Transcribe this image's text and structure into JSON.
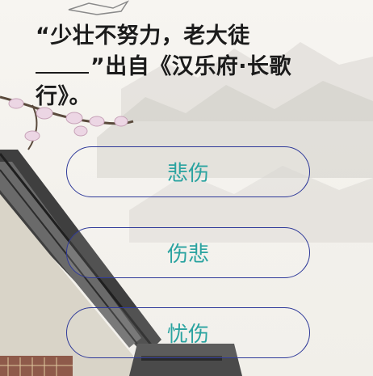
{
  "question": {
    "part1": "“少壮不努力，老大徒",
    "part2": "”出自《汉乐府·长歌行》。"
  },
  "options": [
    {
      "label": "悲伤"
    },
    {
      "label": "伤悲"
    },
    {
      "label": "忧伤"
    }
  ],
  "colors": {
    "option_text": "#2aa3a0",
    "option_border": "#2f3a9a",
    "question_text": "#1b1b1b"
  }
}
